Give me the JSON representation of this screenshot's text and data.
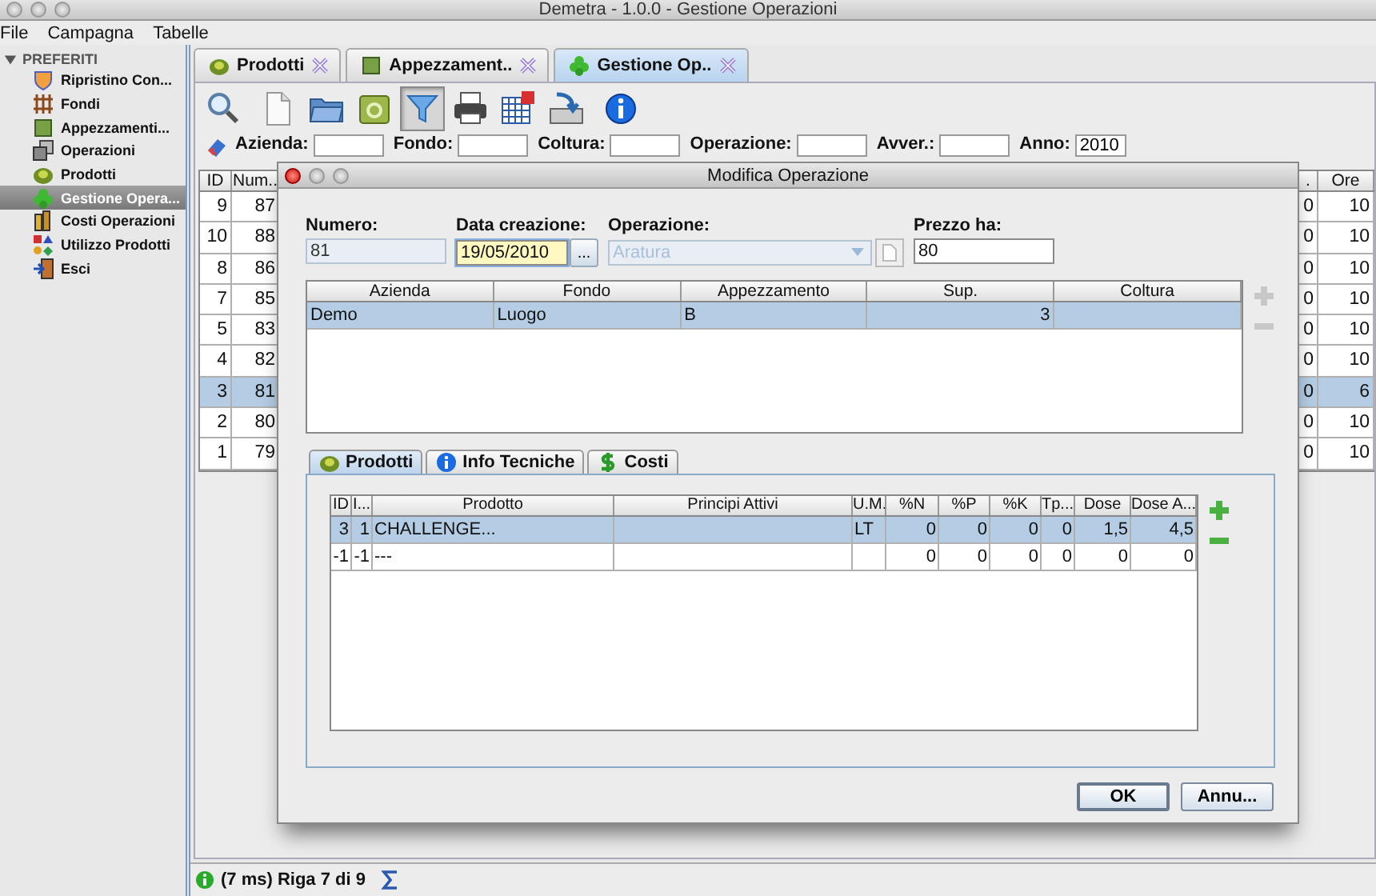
{
  "window": {
    "title": "Demetra - 1.0.0 - Gestione Operazioni"
  },
  "menu": [
    {
      "label": "File"
    },
    {
      "label": "Campagna"
    },
    {
      "label": "Tabelle"
    }
  ],
  "sidebar": {
    "group": {
      "label": "PREFERITI",
      "expanded": true
    },
    "items": [
      {
        "label": "Ripristino Con...",
        "selected": false
      },
      {
        "label": "Fondi",
        "selected": false
      },
      {
        "label": "Appezzamenti...",
        "selected": false
      },
      {
        "label": "Operazioni",
        "selected": false
      },
      {
        "label": "Prodotti",
        "selected": false
      },
      {
        "label": "Gestione Opera...",
        "selected": true
      },
      {
        "label": "Costi Operazioni",
        "selected": false
      },
      {
        "label": "Utilizzo Prodotti",
        "selected": false
      },
      {
        "label": "Esci",
        "selected": false
      }
    ]
  },
  "tabs": [
    {
      "label": "Prodotti",
      "selected": false
    },
    {
      "label": "Appezzament..",
      "selected": false
    },
    {
      "label": "Gestione Op..",
      "selected": true
    }
  ],
  "toolbar": [
    {
      "pressed": false
    },
    {
      "pressed": false
    },
    {
      "pressed": false
    },
    {
      "pressed": false
    },
    {
      "pressed": true
    },
    {
      "pressed": false
    },
    {
      "pressed": false
    },
    {
      "pressed": false
    },
    {
      "pressed": false
    }
  ],
  "filters": [
    {
      "label": "Azienda:"
    },
    {
      "label": "Fondo:"
    },
    {
      "label": "Coltura:"
    },
    {
      "label": "Operazione:"
    },
    {
      "label": "Avver.:"
    },
    {
      "label": "Anno:",
      "value": "2010"
    }
  ],
  "table": {
    "columns": [
      {
        "label": "ID"
      },
      {
        "label": "Num.."
      },
      {
        "label": "."
      },
      {
        "label": "Ore"
      }
    ],
    "rows": [
      {
        "cells": [
          "9",
          "87",
          "0",
          "10"
        ],
        "selected": false
      },
      {
        "cells": [
          "10",
          "88",
          "0",
          "10"
        ],
        "selected": false
      },
      {
        "cells": [
          "8",
          "86",
          "0",
          "10"
        ],
        "selected": false
      },
      {
        "cells": [
          "7",
          "85",
          "0",
          "10"
        ],
        "selected": false
      },
      {
        "cells": [
          "5",
          "83",
          "0",
          "10"
        ],
        "selected": false
      },
      {
        "cells": [
          "4",
          "82",
          "0",
          "10"
        ],
        "selected": false
      },
      {
        "cells": [
          "3",
          "81",
          "0",
          "6"
        ],
        "selected": true
      },
      {
        "cells": [
          "2",
          "80",
          "0",
          "10"
        ],
        "selected": false
      },
      {
        "cells": [
          "1",
          "79",
          "0",
          "10"
        ],
        "selected": false
      }
    ]
  },
  "dialog": {
    "title": "Modifica Operazione",
    "numero": {
      "label": "Numero:",
      "value": "81",
      "disabled": true
    },
    "data_creazione": {
      "label": "Data creazione:",
      "value": "19/05/2010",
      "button": "..."
    },
    "operazione": {
      "label": "Operazione:",
      "value": "Aratura",
      "disabled": true
    },
    "prezzo_ha": {
      "label": "Prezzo ha:",
      "value": "80"
    },
    "locations": {
      "columns": [
        {
          "label": "Azienda"
        },
        {
          "label": "Fondo"
        },
        {
          "label": "Appezzamento"
        },
        {
          "label": "Sup."
        },
        {
          "label": "Coltura"
        }
      ],
      "rows": [
        {
          "cells": [
            "Demo",
            "Luogo",
            "B",
            "3",
            null
          ],
          "selected": true
        }
      ],
      "add_disabled": true,
      "remove_disabled": true
    },
    "tabs": [
      {
        "label": "Prodotti",
        "selected": true
      },
      {
        "label": "Info Tecniche",
        "selected": false
      },
      {
        "label": "Costi",
        "selected": false
      }
    ],
    "products": {
      "columns": [
        {
          "label": "ID"
        },
        {
          "label": "I..."
        },
        {
          "label": "Prodotto"
        },
        {
          "label": "Principi Attivi"
        },
        {
          "label": "U.M."
        },
        {
          "label": "%N"
        },
        {
          "label": "%P"
        },
        {
          "label": "%K"
        },
        {
          "label": "Tp..."
        },
        {
          "label": "Dose"
        },
        {
          "label": "Dose A..."
        }
      ],
      "rows": [
        {
          "cells": [
            "3",
            "1",
            "CHALLENGE...",
            null,
            "LT",
            "0",
            "0",
            "0",
            "0",
            "1,5",
            "4,5"
          ],
          "selected": true
        },
        {
          "cells": [
            "-1",
            "-1",
            "---",
            null,
            null,
            "0",
            "0",
            "0",
            "0",
            "0",
            "0"
          ],
          "selected": false
        }
      ],
      "add_disabled": false,
      "remove_disabled": false
    },
    "buttons": [
      {
        "label": "OK",
        "default": true
      },
      {
        "label": "Annu...",
        "default": false
      }
    ]
  },
  "status_bar": {
    "text": "(7 ms) Riga 7 di 9"
  }
}
